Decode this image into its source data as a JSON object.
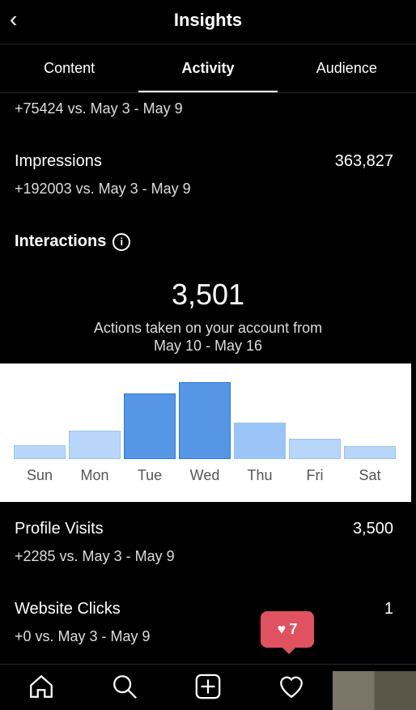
{
  "header": {
    "title": "Insights"
  },
  "tabs": [
    {
      "label": "Content"
    },
    {
      "label": "Activity",
      "active": true
    },
    {
      "label": "Audience"
    }
  ],
  "reach": {
    "comparison": "+75424 vs. May 3 - May 9"
  },
  "impressions": {
    "label": "Impressions",
    "value": "363,827",
    "comparison": "+192003 vs. May 3 - May 9"
  },
  "interactions": {
    "title": "Interactions",
    "total": "3,501",
    "caption_line1": "Actions taken on your account from",
    "caption_line2": "May 10 - May 16"
  },
  "chart_data": {
    "type": "bar",
    "categories": [
      "Sun",
      "Mon",
      "Tue",
      "Wed",
      "Thu",
      "Fri",
      "Sat"
    ],
    "values": [
      17,
      35,
      80,
      94,
      45,
      25,
      16
    ],
    "highlighted": [
      "Tue",
      "Wed"
    ],
    "colors": {
      "highlight": "#5596e6",
      "normal": "#b8d6f9",
      "thu": "#9cc5f7"
    },
    "grid": false
  },
  "profile_visits": {
    "label": "Profile Visits",
    "value": "3,500",
    "comparison": "+2285 vs. May 3 - May 9"
  },
  "website_clicks": {
    "label": "Website Clicks",
    "value": "1",
    "comparison": "+0 vs. May 3 - May 9"
  },
  "notification_badge": {
    "count": "7",
    "color": "#e0525f"
  },
  "nav": {
    "icons": [
      "home-icon",
      "search-icon",
      "add-icon",
      "heart-icon",
      "profile-avatar"
    ]
  }
}
